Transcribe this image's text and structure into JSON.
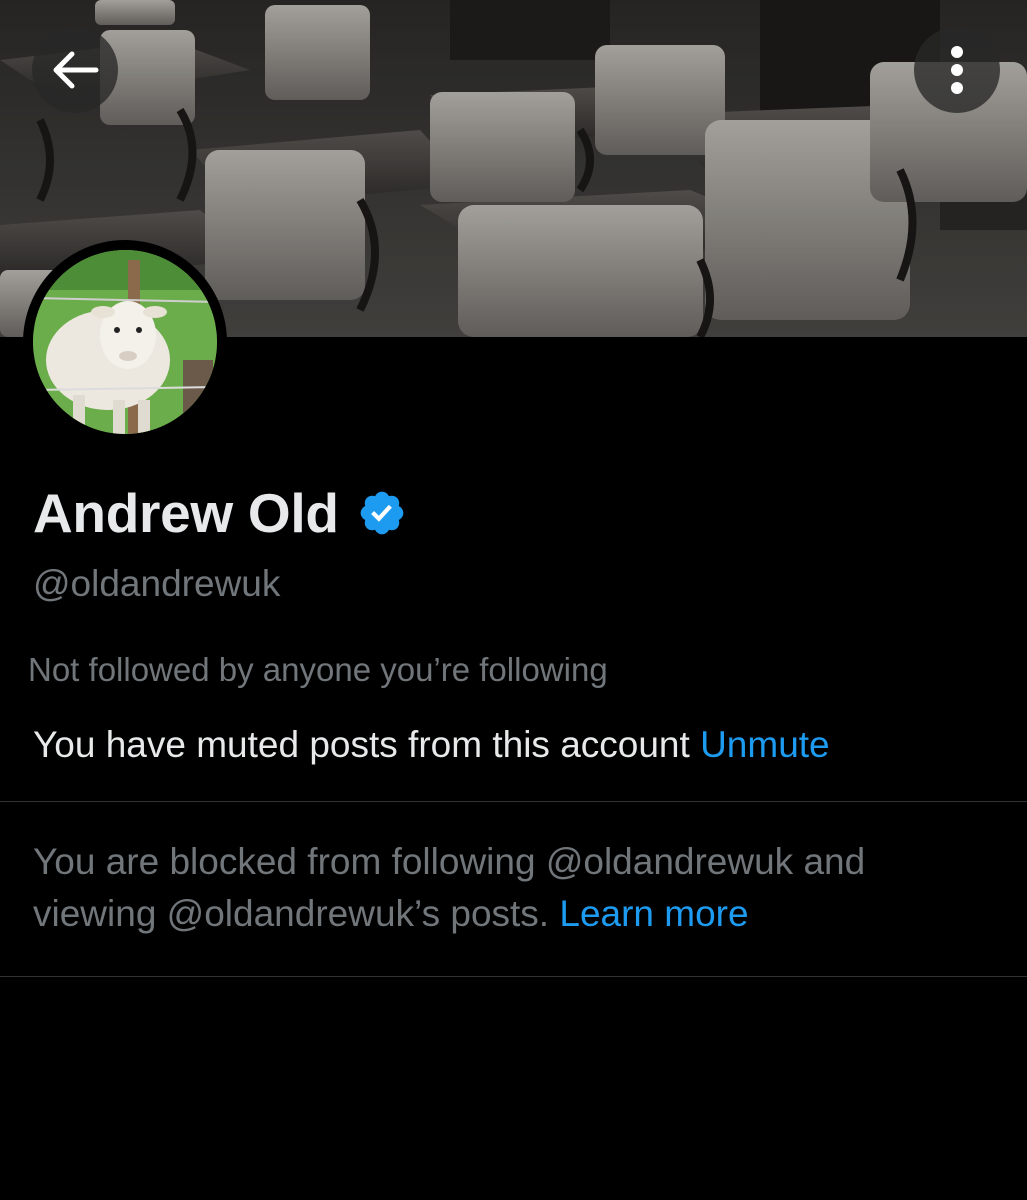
{
  "profile": {
    "display_name": "Andrew Old",
    "handle": "@oldandrewuk",
    "verified": true,
    "verified_color": "#1d9bf0"
  },
  "header": {
    "back_icon": "arrow-left-icon",
    "more_icon": "more-vertical-icon",
    "banner_description": "",
    "avatar_description": ""
  },
  "follow_context": "Not followed by anyone you’re following",
  "mute_notice": {
    "text": "You have muted posts from this account",
    "action": "Unmute"
  },
  "block_notice": {
    "text": "You are blocked from following @oldandrewuk and viewing @oldandrewuk’s posts.",
    "link": "Learn more"
  },
  "colors": {
    "background": "#000000",
    "primary_text": "#e7e9ea",
    "secondary_text": "#71767b",
    "link": "#1d9bf0",
    "divider": "#2f3336"
  }
}
